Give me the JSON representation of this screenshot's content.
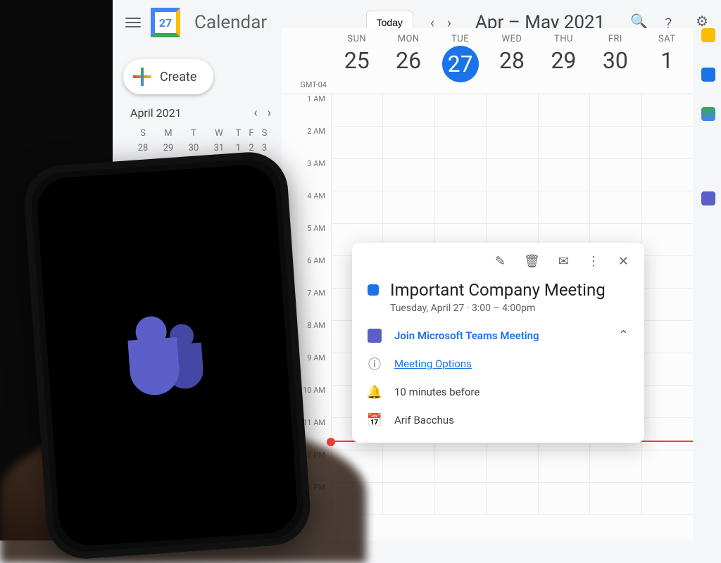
{
  "app": {
    "name": "Calendar",
    "logo_day": "27"
  },
  "header": {
    "today": "Today",
    "range": "Apr – May 2021",
    "timezone": "GMT-04"
  },
  "create": {
    "label": "Create"
  },
  "mini": {
    "month": "April 2021",
    "dows": [
      "S",
      "M",
      "T",
      "W",
      "T",
      "F",
      "S"
    ],
    "row1": [
      "28",
      "29",
      "30",
      "31",
      "1",
      "2",
      "3"
    ]
  },
  "week": {
    "dows": [
      "SUN",
      "MON",
      "TUE",
      "WED",
      "THU",
      "FRI",
      "SAT"
    ],
    "doms": [
      "25",
      "26",
      "27",
      "28",
      "29",
      "30",
      "1"
    ],
    "today_index": 2,
    "hours": [
      "1 AM",
      "2 AM",
      "3 AM",
      "4 AM",
      "5 AM",
      "6 AM",
      "7 AM",
      "8 AM",
      "9 AM",
      "10 AM",
      "11 AM",
      "12 PM",
      "1 PM"
    ]
  },
  "event": {
    "title": "Important Company Meeting",
    "when": "Tuesday, April 27  ·  3:00 – 4:00pm",
    "join_label": "Join Microsoft Teams Meeting",
    "options_label": "Meeting Options",
    "reminder": "10 minutes before",
    "organizer": "Arif Bacchus"
  }
}
